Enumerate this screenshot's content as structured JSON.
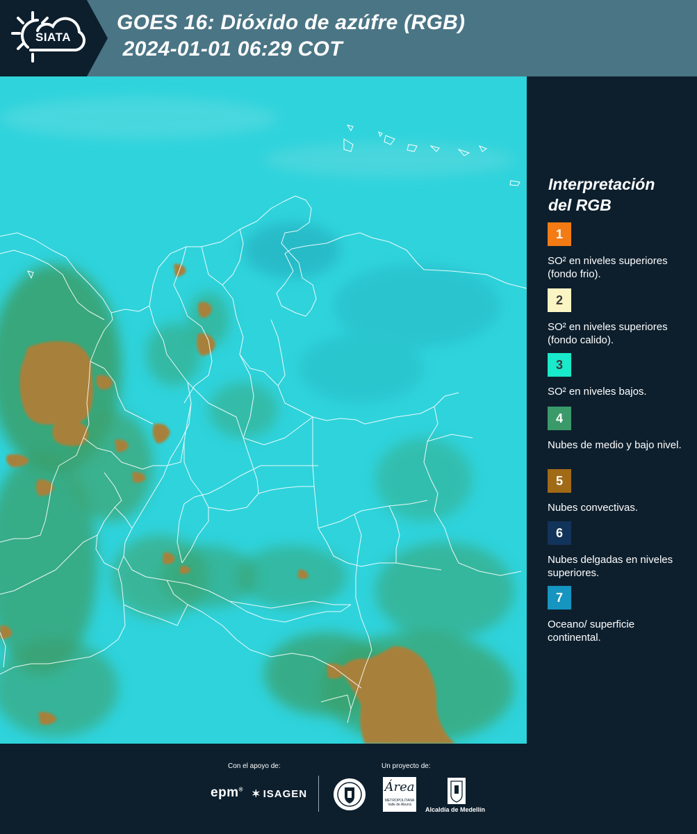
{
  "header": {
    "logo_text": "SIATA",
    "title_line1": "GOES 16: Dióxido de azúfre (RGB)",
    "title_line2": " 2024-01-01 06:29 COT"
  },
  "legend": {
    "title_line1": "Interpretación",
    "title_line2": "del RGB",
    "items": [
      {
        "number": "1",
        "color": "#f37b14",
        "text_color": "#ffffff",
        "description": "SO² en niveles superiores (fondo frio)."
      },
      {
        "number": "2",
        "color": "#fbf5c4",
        "text_color": "#3b3b3b",
        "description": "SO² en niveles superiores (fondo calido)."
      },
      {
        "number": "3",
        "color": "#19eacb",
        "text_color": "#3b3b3b",
        "description": "SO² en niveles bajos."
      },
      {
        "number": "4",
        "color": "#3b9a6a",
        "text_color": "#ffffff",
        "description": "Nubes de medio y bajo nivel."
      },
      {
        "number": "5",
        "color": "#a16a17",
        "text_color": "#ffffff",
        "description": "Nubes convectivas."
      },
      {
        "number": "6",
        "color": "#12335a",
        "text_color": "#ffffff",
        "description": "Nubes delgadas en niveles superiores."
      },
      {
        "number": "7",
        "color": "#1595c0",
        "text_color": "#ffffff",
        "description": "Oceano/ superficie continental."
      }
    ]
  },
  "footer": {
    "support_label": "Con el apoyo de:",
    "project_label": "Un proyecto de:",
    "sponsor_epm": "epm",
    "sponsor_isagen": "ISAGEN",
    "partner_area_name": "Área",
    "partner_area_sub": "METROPOLITANA",
    "partner_area_sub2": "Valle de Aburrá",
    "partner_alcaldia": "Alcaldía de Medellín"
  },
  "colors": {
    "background": "#0d1f2d",
    "header_band": "#4a7585",
    "sea": "#2fd3dc",
    "land_haze": "#32c4c6",
    "low_cloud": "#3aa06c",
    "convective": "#a7813a",
    "border_line": "#ffffff"
  }
}
